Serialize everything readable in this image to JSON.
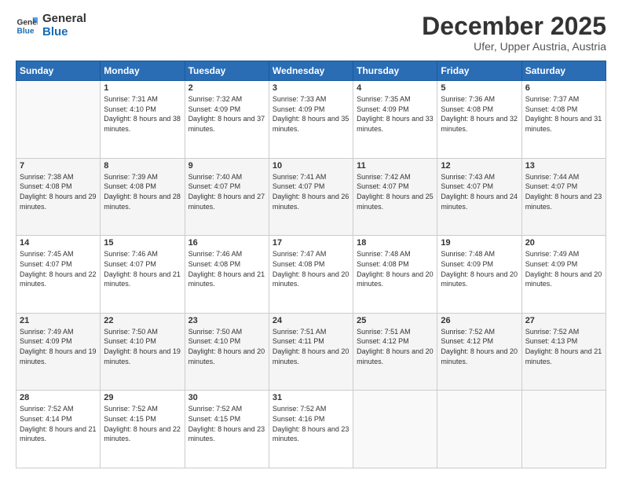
{
  "logo": {
    "line1": "General",
    "line2": "Blue"
  },
  "header": {
    "month": "December 2025",
    "location": "Ufer, Upper Austria, Austria"
  },
  "weekdays": [
    "Sunday",
    "Monday",
    "Tuesday",
    "Wednesday",
    "Thursday",
    "Friday",
    "Saturday"
  ],
  "weeks": [
    [
      {
        "day": "",
        "empty": true
      },
      {
        "day": "1",
        "sunrise": "Sunrise: 7:31 AM",
        "sunset": "Sunset: 4:10 PM",
        "daylight": "Daylight: 8 hours and 38 minutes."
      },
      {
        "day": "2",
        "sunrise": "Sunrise: 7:32 AM",
        "sunset": "Sunset: 4:09 PM",
        "daylight": "Daylight: 8 hours and 37 minutes."
      },
      {
        "day": "3",
        "sunrise": "Sunrise: 7:33 AM",
        "sunset": "Sunset: 4:09 PM",
        "daylight": "Daylight: 8 hours and 35 minutes."
      },
      {
        "day": "4",
        "sunrise": "Sunrise: 7:35 AM",
        "sunset": "Sunset: 4:09 PM",
        "daylight": "Daylight: 8 hours and 33 minutes."
      },
      {
        "day": "5",
        "sunrise": "Sunrise: 7:36 AM",
        "sunset": "Sunset: 4:08 PM",
        "daylight": "Daylight: 8 hours and 32 minutes."
      },
      {
        "day": "6",
        "sunrise": "Sunrise: 7:37 AM",
        "sunset": "Sunset: 4:08 PM",
        "daylight": "Daylight: 8 hours and 31 minutes."
      }
    ],
    [
      {
        "day": "7",
        "sunrise": "Sunrise: 7:38 AM",
        "sunset": "Sunset: 4:08 PM",
        "daylight": "Daylight: 8 hours and 29 minutes."
      },
      {
        "day": "8",
        "sunrise": "Sunrise: 7:39 AM",
        "sunset": "Sunset: 4:08 PM",
        "daylight": "Daylight: 8 hours and 28 minutes."
      },
      {
        "day": "9",
        "sunrise": "Sunrise: 7:40 AM",
        "sunset": "Sunset: 4:07 PM",
        "daylight": "Daylight: 8 hours and 27 minutes."
      },
      {
        "day": "10",
        "sunrise": "Sunrise: 7:41 AM",
        "sunset": "Sunset: 4:07 PM",
        "daylight": "Daylight: 8 hours and 26 minutes."
      },
      {
        "day": "11",
        "sunrise": "Sunrise: 7:42 AM",
        "sunset": "Sunset: 4:07 PM",
        "daylight": "Daylight: 8 hours and 25 minutes."
      },
      {
        "day": "12",
        "sunrise": "Sunrise: 7:43 AM",
        "sunset": "Sunset: 4:07 PM",
        "daylight": "Daylight: 8 hours and 24 minutes."
      },
      {
        "day": "13",
        "sunrise": "Sunrise: 7:44 AM",
        "sunset": "Sunset: 4:07 PM",
        "daylight": "Daylight: 8 hours and 23 minutes."
      }
    ],
    [
      {
        "day": "14",
        "sunrise": "Sunrise: 7:45 AM",
        "sunset": "Sunset: 4:07 PM",
        "daylight": "Daylight: 8 hours and 22 minutes."
      },
      {
        "day": "15",
        "sunrise": "Sunrise: 7:46 AM",
        "sunset": "Sunset: 4:07 PM",
        "daylight": "Daylight: 8 hours and 21 minutes."
      },
      {
        "day": "16",
        "sunrise": "Sunrise: 7:46 AM",
        "sunset": "Sunset: 4:08 PM",
        "daylight": "Daylight: 8 hours and 21 minutes."
      },
      {
        "day": "17",
        "sunrise": "Sunrise: 7:47 AM",
        "sunset": "Sunset: 4:08 PM",
        "daylight": "Daylight: 8 hours and 20 minutes."
      },
      {
        "day": "18",
        "sunrise": "Sunrise: 7:48 AM",
        "sunset": "Sunset: 4:08 PM",
        "daylight": "Daylight: 8 hours and 20 minutes."
      },
      {
        "day": "19",
        "sunrise": "Sunrise: 7:48 AM",
        "sunset": "Sunset: 4:09 PM",
        "daylight": "Daylight: 8 hours and 20 minutes."
      },
      {
        "day": "20",
        "sunrise": "Sunrise: 7:49 AM",
        "sunset": "Sunset: 4:09 PM",
        "daylight": "Daylight: 8 hours and 20 minutes."
      }
    ],
    [
      {
        "day": "21",
        "sunrise": "Sunrise: 7:49 AM",
        "sunset": "Sunset: 4:09 PM",
        "daylight": "Daylight: 8 hours and 19 minutes."
      },
      {
        "day": "22",
        "sunrise": "Sunrise: 7:50 AM",
        "sunset": "Sunset: 4:10 PM",
        "daylight": "Daylight: 8 hours and 19 minutes."
      },
      {
        "day": "23",
        "sunrise": "Sunrise: 7:50 AM",
        "sunset": "Sunset: 4:10 PM",
        "daylight": "Daylight: 8 hours and 20 minutes."
      },
      {
        "day": "24",
        "sunrise": "Sunrise: 7:51 AM",
        "sunset": "Sunset: 4:11 PM",
        "daylight": "Daylight: 8 hours and 20 minutes."
      },
      {
        "day": "25",
        "sunrise": "Sunrise: 7:51 AM",
        "sunset": "Sunset: 4:12 PM",
        "daylight": "Daylight: 8 hours and 20 minutes."
      },
      {
        "day": "26",
        "sunrise": "Sunrise: 7:52 AM",
        "sunset": "Sunset: 4:12 PM",
        "daylight": "Daylight: 8 hours and 20 minutes."
      },
      {
        "day": "27",
        "sunrise": "Sunrise: 7:52 AM",
        "sunset": "Sunset: 4:13 PM",
        "daylight": "Daylight: 8 hours and 21 minutes."
      }
    ],
    [
      {
        "day": "28",
        "sunrise": "Sunrise: 7:52 AM",
        "sunset": "Sunset: 4:14 PM",
        "daylight": "Daylight: 8 hours and 21 minutes."
      },
      {
        "day": "29",
        "sunrise": "Sunrise: 7:52 AM",
        "sunset": "Sunset: 4:15 PM",
        "daylight": "Daylight: 8 hours and 22 minutes."
      },
      {
        "day": "30",
        "sunrise": "Sunrise: 7:52 AM",
        "sunset": "Sunset: 4:15 PM",
        "daylight": "Daylight: 8 hours and 23 minutes."
      },
      {
        "day": "31",
        "sunrise": "Sunrise: 7:52 AM",
        "sunset": "Sunset: 4:16 PM",
        "daylight": "Daylight: 8 hours and 23 minutes."
      },
      {
        "day": "",
        "empty": true
      },
      {
        "day": "",
        "empty": true
      },
      {
        "day": "",
        "empty": true
      }
    ]
  ]
}
